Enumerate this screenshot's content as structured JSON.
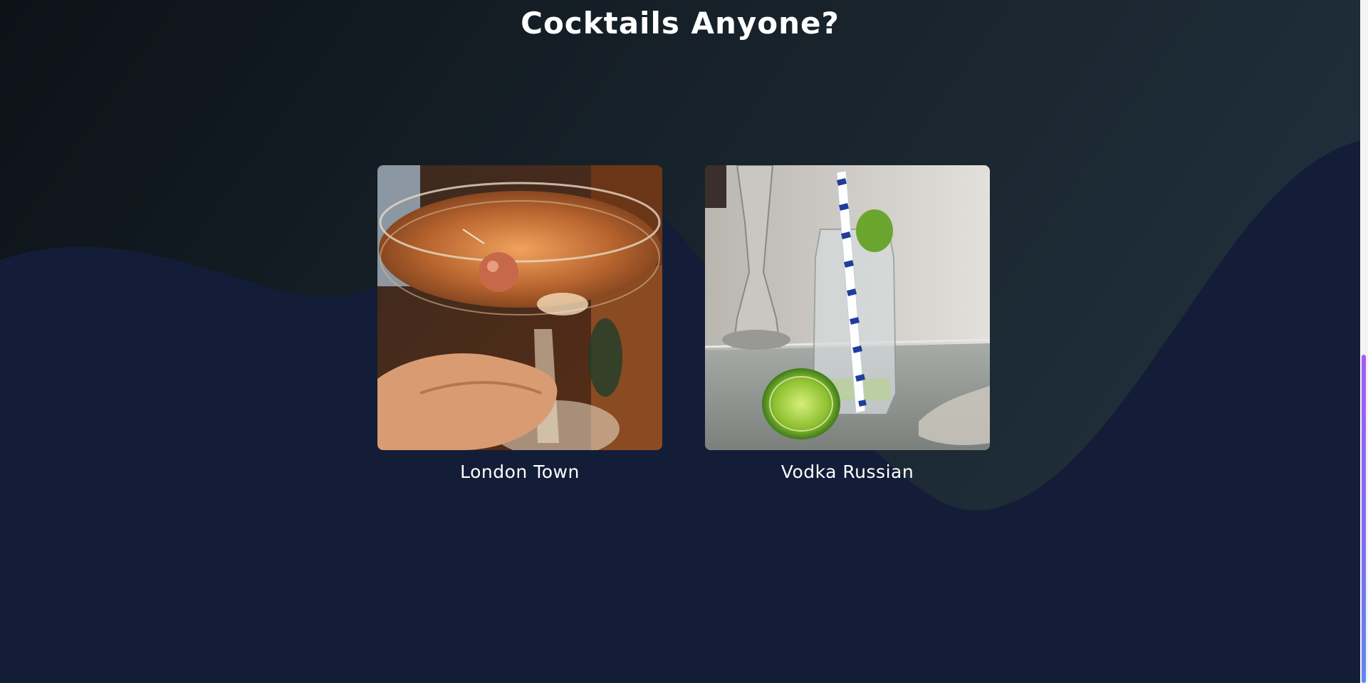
{
  "section": {
    "title": "Cocktails Anyone?"
  },
  "cocktails": [
    {
      "name": "London Town",
      "image_icon": "cocktail-coupe-glass-photo"
    },
    {
      "name": "Vodka Russian",
      "image_icon": "vodka-jar-with-lime-photo"
    }
  ],
  "colors": {
    "background_top": "#0c1218",
    "background_wave": "#131d37",
    "text": "#ffffff",
    "scroll_thumb_top": "#a35cf5",
    "scroll_thumb_bottom": "#5d86f2"
  }
}
